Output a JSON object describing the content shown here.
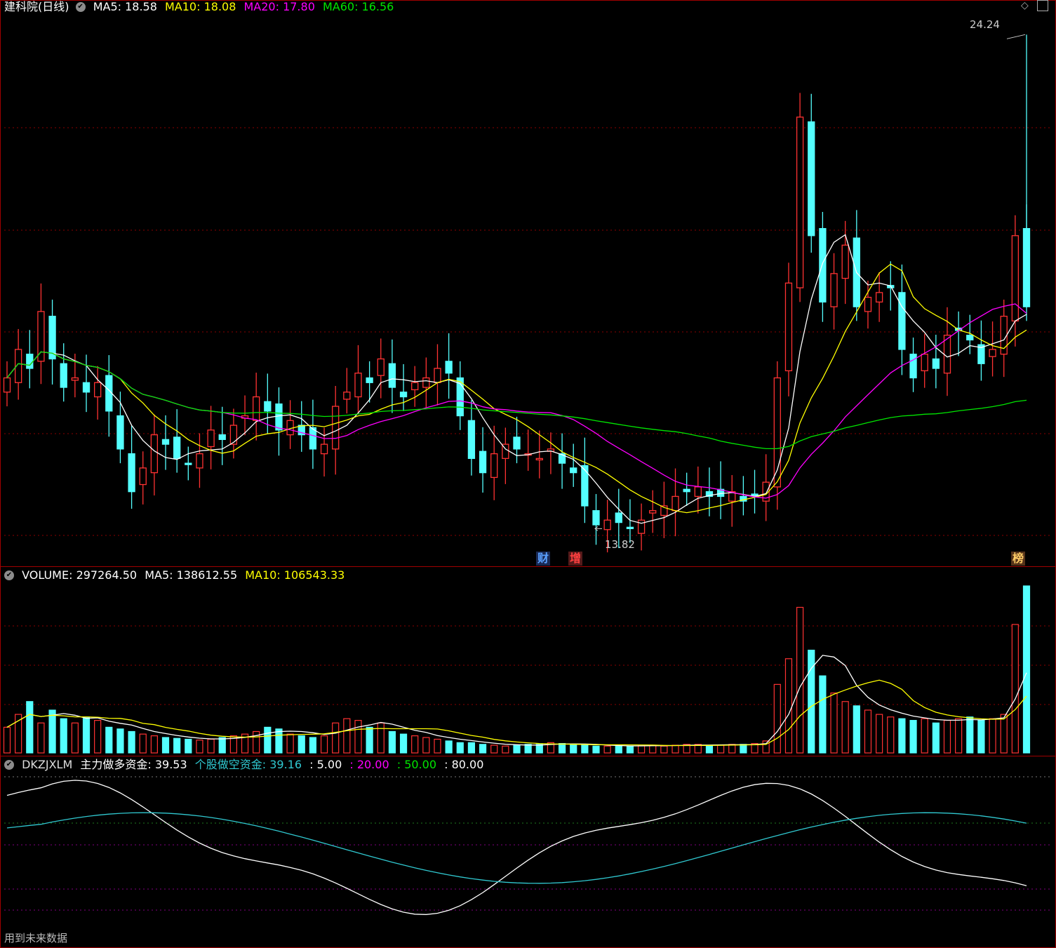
{
  "main_pane": {
    "title": "建科院(日线)",
    "ma5": "MA5: 18.58",
    "ma10": "MA10: 18.08",
    "ma20": "MA20: 17.80",
    "ma60": "MA60: 16.56",
    "high_label": "24.24",
    "low_label": "13.82",
    "badges": [
      "财",
      "增",
      "榜"
    ]
  },
  "volume_pane": {
    "label": "VOLUME: 297264.50",
    "ma5": "MA5: 138612.55",
    "ma10": "MA10: 106543.33"
  },
  "indicator_pane": {
    "name": "DKZJXLM",
    "long_funds": "主力做多资金: 39.53",
    "short_funds": "个股做空资金: 39.16",
    "level1": ": 5.00",
    "level2": ": 20.00",
    "level3": ": 50.00",
    "level4": ": 80.00",
    "footer_note": "用到未来数据"
  },
  "colors": {
    "up": "#ff3232",
    "down": "#54ffff",
    "ma5": "#ffffff",
    "ma10": "#ffff00",
    "ma20": "#ff00ff",
    "ma60": "#00e600",
    "grid": "#8b0000"
  },
  "chart_data": {
    "type": "candlestick",
    "ylim_price": [
      13.5,
      24.6
    ],
    "closes": [
      17.0,
      17.6,
      17.2,
      18.4,
      17.4,
      16.8,
      17.0,
      16.7,
      16.9,
      16.3,
      15.5,
      14.6,
      15.1,
      15.8,
      15.6,
      15.3,
      15.2,
      15.4,
      15.9,
      15.7,
      16.0,
      16.2,
      16.6,
      16.3,
      15.9,
      16.1,
      15.8,
      15.5,
      15.6,
      16.4,
      16.7,
      17.1,
      16.9,
      17.4,
      16.8,
      16.6,
      16.9,
      17.0,
      17.2,
      17.1,
      16.2,
      15.3,
      15.0,
      15.4,
      15.6,
      15.5,
      15.4,
      15.3,
      15.5,
      15.2,
      15.0,
      14.3,
      13.9,
      14.0,
      13.95,
      13.82,
      14.0,
      14.2,
      14.3,
      14.5,
      14.6,
      14.7,
      14.5,
      14.5,
      14.6,
      14.4,
      14.5,
      14.8,
      17.0,
      19.0,
      22.5,
      20.0,
      18.6,
      19.2,
      19.8,
      18.5,
      18.7,
      18.8,
      18.9,
      17.6,
      17.0,
      17.5,
      17.2,
      17.9,
      18.0,
      17.8,
      17.3,
      17.6,
      18.3,
      20.0,
      18.5
    ],
    "volumes": [
      30,
      45,
      60,
      35,
      50,
      40,
      35,
      42,
      38,
      30,
      28,
      25,
      22,
      20,
      18,
      17,
      16,
      15,
      16,
      18,
      20,
      22,
      25,
      30,
      28,
      22,
      20,
      18,
      20,
      35,
      40,
      38,
      30,
      35,
      25,
      22,
      20,
      18,
      16,
      14,
      12,
      12,
      10,
      9,
      8,
      9,
      10,
      10,
      12,
      11,
      10,
      9,
      8,
      8,
      8,
      8,
      9,
      9,
      8,
      9,
      10,
      10,
      9,
      9,
      10,
      10,
      11,
      14,
      80,
      110,
      170,
      120,
      90,
      70,
      60,
      55,
      50,
      45,
      42,
      40,
      38,
      40,
      35,
      38,
      40,
      42,
      38,
      40,
      45,
      150,
      195
    ]
  }
}
